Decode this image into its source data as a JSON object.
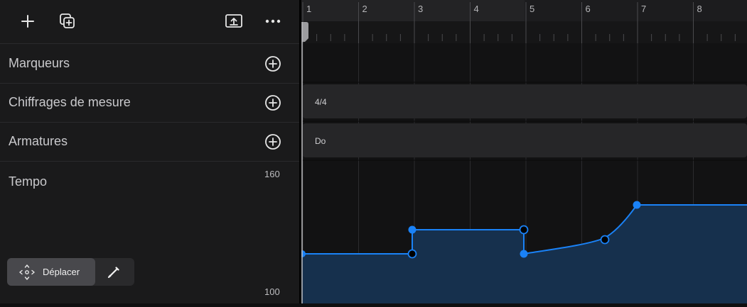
{
  "toolbar": {
    "add_icon": "plus-icon",
    "duplicate_icon": "duplicate-add-icon",
    "export_icon": "upload-tray-icon",
    "more_icon": "ellipsis-icon"
  },
  "tracks": [
    {
      "label": "Marqueurs"
    },
    {
      "label": "Chiffrages de mesure",
      "region": "4/4"
    },
    {
      "label": "Armatures",
      "region": "Do"
    }
  ],
  "tempo": {
    "label": "Tempo",
    "max": "160",
    "min": "100"
  },
  "modes": {
    "move_label": "Déplacer",
    "move_icon": "move-arrows-icon",
    "pencil_icon": "pencil-icon"
  },
  "ruler": {
    "bars": [
      "1",
      "2",
      "3",
      "4",
      "5",
      "6",
      "7",
      "8"
    ]
  },
  "colors": {
    "accent": "#1a82f7",
    "fill": "#16304d",
    "panel": "#1a1a1b",
    "background": "#121213"
  }
}
